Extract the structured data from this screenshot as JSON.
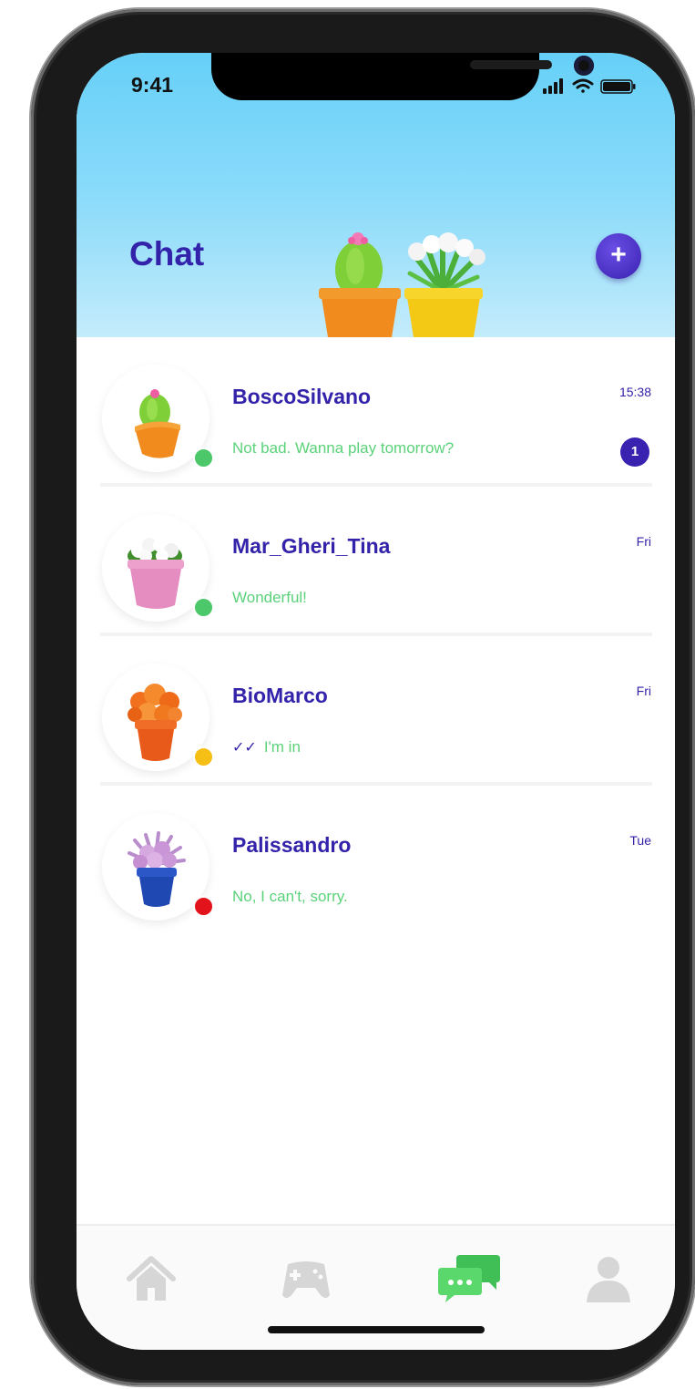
{
  "status_bar": {
    "time": "9:41"
  },
  "header": {
    "title": "Chat",
    "add_button_label": "+"
  },
  "colors": {
    "primary": "#3322aa",
    "message_text": "#5bd27a",
    "online": "#4cc76a",
    "away": "#f6bf16",
    "busy": "#e3131b",
    "active_tab": "#4cc76a",
    "inactive_tab": "#d6d6d6"
  },
  "chats": [
    {
      "name": "BoscoSilvano",
      "message": "Not bad. Wanna play tomorrow?",
      "time": "15:38",
      "unread": "1",
      "status": "online",
      "avatar_icon": "cactus-pot-icon",
      "read_receipt": ""
    },
    {
      "name": "Mar_Gheri_Tina",
      "message": "Wonderful!",
      "time": "Fri",
      "unread": "",
      "status": "online",
      "avatar_icon": "white-flower-pot-icon",
      "read_receipt": ""
    },
    {
      "name": "BioMarco",
      "message": "I'm in",
      "time": "Fri",
      "unread": "",
      "status": "away",
      "avatar_icon": "orange-flower-pot-icon",
      "read_receipt": "✓✓"
    },
    {
      "name": "Palissandro",
      "message": "No, I can't, sorry.",
      "time": "Tue",
      "unread": "",
      "status": "busy",
      "avatar_icon": "purple-flower-pot-icon",
      "read_receipt": ""
    }
  ],
  "tabs": [
    {
      "id": "home",
      "icon": "home-icon",
      "active": false
    },
    {
      "id": "games",
      "icon": "gamepad-icon",
      "active": false
    },
    {
      "id": "chat",
      "icon": "chat-bubbles-icon",
      "active": true
    },
    {
      "id": "profile",
      "icon": "person-icon",
      "active": false
    }
  ]
}
